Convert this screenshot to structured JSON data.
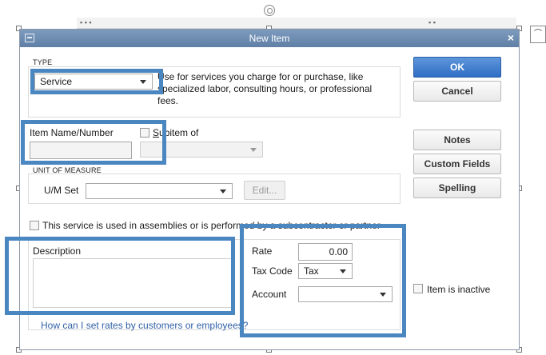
{
  "dialog": {
    "title": "New Item",
    "close_glyph": "×"
  },
  "type_section": {
    "label": "TYPE",
    "selected": "Service",
    "description": "Use for services you charge for or purchase, like specialized labor, consulting hours, or professional fees."
  },
  "item": {
    "name_label": "Item Name/Number",
    "subitem_label": "Subitem of",
    "subitem_underline": "u"
  },
  "uom": {
    "label": "UNIT OF MEASURE",
    "set_label": "U/M Set",
    "edit_label": "Edit..."
  },
  "assembly_checkbox": {
    "label": "This service is used in assemblies or is performed by a subcontractor or partner"
  },
  "description": {
    "label": "Description"
  },
  "rate": {
    "label": "Rate",
    "value": "0.00"
  },
  "tax": {
    "label": "Tax Code",
    "value": "Tax"
  },
  "account": {
    "label": "Account"
  },
  "buttons": {
    "ok": "OK",
    "cancel": "Cancel",
    "notes": "Notes",
    "custom_fields": "Custom Fields",
    "spelling": "Spelling"
  },
  "inactive": {
    "label": "Item is inactive"
  },
  "help_link": "How can I set rates by customers or employees?",
  "colors": {
    "highlight": "#4a86c0",
    "primary_button": "#2f6ec4",
    "titlebar": "#6a88ae",
    "link": "#2f5fa6"
  }
}
